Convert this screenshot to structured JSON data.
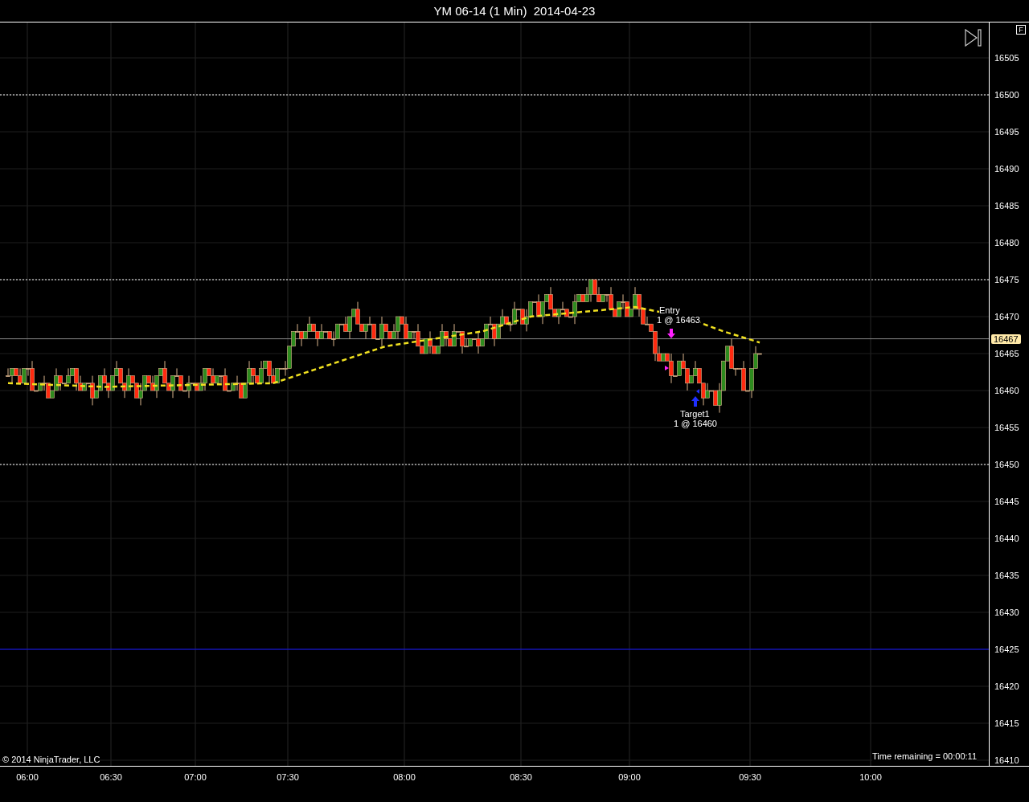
{
  "title": "YM 06-14 (1 Min)  2014-04-23",
  "panel_button": "F",
  "price_axis": {
    "labels": [
      "16505",
      "16500",
      "16495",
      "16490",
      "16485",
      "16480",
      "16475",
      "16470",
      "16465",
      "16460",
      "16455",
      "16450",
      "16445",
      "16440",
      "16435",
      "16430",
      "16425",
      "16420",
      "16415",
      "16410"
    ],
    "last_price": "16467"
  },
  "time_axis": {
    "labels": [
      "06:00",
      "06:30",
      "07:00",
      "07:30",
      "08:00",
      "08:30",
      "09:00",
      "09:30",
      "10:00"
    ]
  },
  "annotations": [
    {
      "kind": "entry",
      "title": "Entry",
      "detail": "1 @ 16463"
    },
    {
      "kind": "target",
      "title": "Target1",
      "detail": "1 @ 16460"
    }
  ],
  "copyright": "© 2014 NinjaTrader, LLC",
  "time_remaining": "Time remaining = 00:00:11"
}
